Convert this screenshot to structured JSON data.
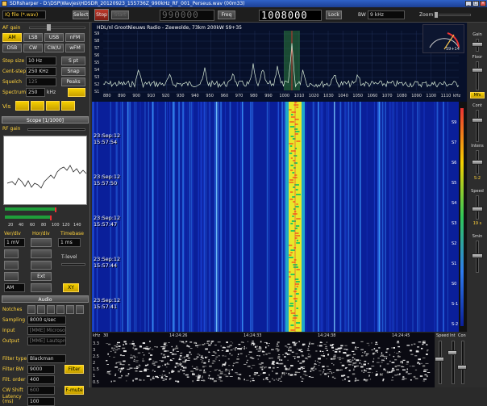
{
  "window": {
    "title": "SDRsharper - D:\\DSP\\Wavjes\\HDSDR_20120923_155736Z_990kHz_RF_001_Perseus.wav (00m33)"
  },
  "toolbar": {
    "source": "IQ file (*.wav)",
    "select": "Select",
    "stop": "Stop",
    "start": "Start",
    "center_freq": "990000",
    "freq_label": "Freq",
    "freq": "1008000",
    "lock": "Lock",
    "bw_label": "BW",
    "bw": "9 kHz",
    "zoom_label": "Zoom"
  },
  "left": {
    "af_gain": "AF gain",
    "modes": [
      "AM",
      "LSB",
      "USB",
      "nFM",
      "DSB",
      "CW",
      "CW/U",
      "wFM"
    ],
    "step_size_label": "Step size",
    "step_size": "10 Hz",
    "s_pt": "S pt",
    "cent_step_label": "Cent-step",
    "cent_step": "250 KHz",
    "snap": "Snap",
    "squelch_label": "Squelch",
    "squelch": "125",
    "peaks": "Peaks",
    "spectrum_label": "Spectrum",
    "spectrum": "250",
    "khz": "kHz",
    "vis_label": "Vis",
    "scope_header": "Scope [1/1000]",
    "rf_gain": "RF gain",
    "scope_ticks": [
      "20",
      "40",
      "60",
      "80",
      "100",
      "120",
      "140"
    ],
    "vert_div": "Ver/div",
    "hor_div": "Hor/div",
    "timebase": "Timebase",
    "vdiv_value": "1 mV",
    "tdiv_value": "1 ms",
    "t_level": "T-level",
    "ext": "Ext",
    "xy": "XY",
    "am_sel": "AM",
    "audio_header": "Audio",
    "notches": "Notches",
    "sampling_label": "Sampling",
    "sampling": "8000 s/sec",
    "input_label": "Input",
    "input": "[MME] Microsoft S",
    "output_label": "Output",
    "output": "[MME] Lautsprecher",
    "filter_type_label": "Filter type",
    "filter_type": "Blackman",
    "filter_bw_label": "Filter BW",
    "filter_bw": "9000",
    "filter_btn": "Filter",
    "filt_order_label": "Filt. order",
    "filt_order": "400",
    "cw_shift_label": "CW Shift",
    "cw_shift": "600",
    "fmute": "F-mute",
    "latency_label": "Latency (ms)",
    "latency": "100"
  },
  "spectrum": {
    "station": "HDL/nl GrootNieuws Radio - Zeewolde, 73km 200kW S9+35",
    "s_labels": [
      "S9",
      "S8",
      "S7",
      "S6",
      "S5",
      "S4",
      "S3",
      "S2",
      "S1"
    ],
    "freq_labels": [
      "880",
      "890",
      "900",
      "910",
      "920",
      "930",
      "940",
      "950",
      "960",
      "970",
      "980",
      "990",
      "1000",
      "1010",
      "1020",
      "1030",
      "1040",
      "1050",
      "1060",
      "1070",
      "1080",
      "1090",
      "1100",
      "1110"
    ],
    "unit": "kHz",
    "meter_label": "S9+14"
  },
  "waterfall": {
    "timestamps": [
      "23:Sep:12\n15:57:54",
      "23:Sep:12\n15:57:50",
      "23:Sep:12\n15:57:47",
      "23:Sep:12\n15:57:44",
      "23:Sep:12\n15:57:41"
    ],
    "scale": [
      "S9",
      "S7",
      "S6",
      "S5",
      "S4",
      "S3",
      "S2",
      "S1",
      "S0",
      "S-1",
      "S-2"
    ]
  },
  "audio_spec": {
    "y_labels": [
      "3.3",
      "3",
      "2.5",
      "2",
      "1.5",
      "1",
      "0.5"
    ],
    "times": [
      "14:24:26",
      "14:24:33",
      "14:24:38",
      "14:24:45"
    ],
    "khz": "kHz",
    "start": "30",
    "controls": [
      "Speed",
      "Int",
      "Con"
    ]
  },
  "right": {
    "gain": "Gain",
    "floor": "Floor",
    "mfs": "Mfs",
    "cont": "Cont",
    "intens": "Intens",
    "speed": "Speed",
    "spd_val": "S-2",
    "spd2": "19 s",
    "smin": "Smin"
  }
}
